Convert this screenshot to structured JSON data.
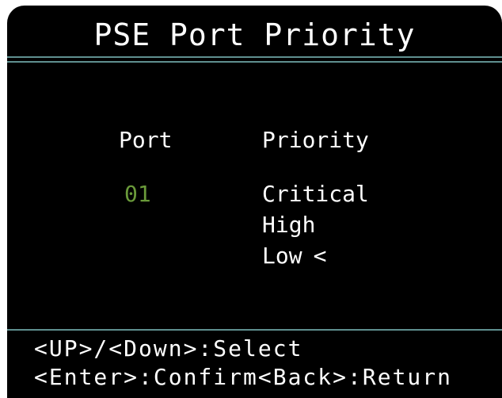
{
  "header": {
    "title": "PSE Port Priority"
  },
  "table": {
    "port_header": "Port",
    "priority_header": "Priority",
    "port_value": "01"
  },
  "priority_options": [
    {
      "label": "Critical",
      "selected": false
    },
    {
      "label": "High",
      "selected": false
    },
    {
      "label": "Low",
      "selected": true
    }
  ],
  "selection_marker": "<",
  "footer": {
    "line1": "<UP>/<Down>:Select",
    "line2": "<Enter>:Confirm<Back>:Return"
  },
  "colors": {
    "background": "#000000",
    "text": "#ffffff",
    "port_value": "#6a9a3a",
    "rule": "#5f8f8f"
  }
}
